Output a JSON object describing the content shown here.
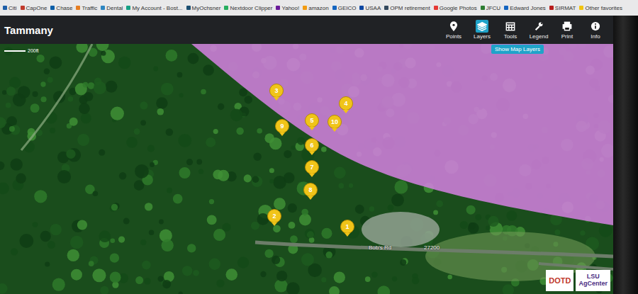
{
  "bookmarks": [
    {
      "label": "Citi"
    },
    {
      "label": "CapOne"
    },
    {
      "label": "Chase"
    },
    {
      "label": "Traffic"
    },
    {
      "label": "Dental"
    },
    {
      "label": "My Account - Bost..."
    },
    {
      "label": "MyOchsner"
    },
    {
      "label": "Nextdoor Clipper"
    },
    {
      "label": "Yahoo!"
    },
    {
      "label": "amazon"
    },
    {
      "label": "GEICO"
    },
    {
      "label": "USAA"
    },
    {
      "label": "OPM retirement"
    },
    {
      "label": "Google Photos"
    },
    {
      "label": "JFCU"
    },
    {
      "label": "Edward Jones"
    },
    {
      "label": "SIRMAT"
    },
    {
      "label": "Other favorites"
    }
  ],
  "app": {
    "title": "Tammany"
  },
  "toolbar": [
    {
      "label": "Points",
      "selected": false
    },
    {
      "label": "Layers",
      "selected": true
    },
    {
      "label": "Tools",
      "selected": false
    },
    {
      "label": "Legend",
      "selected": false
    },
    {
      "label": "Print",
      "selected": false
    },
    {
      "label": "Info",
      "selected": false
    }
  ],
  "tooltip": "Show Map Layers",
  "map": {
    "scale": "200ft",
    "roads": [
      {
        "label": "Bob's Rd"
      },
      {
        "label": "27200"
      }
    ],
    "pins": [
      {
        "label": "1"
      },
      {
        "label": "2"
      },
      {
        "label": "3"
      },
      {
        "label": "4"
      },
      {
        "label": "5"
      },
      {
        "label": "6"
      },
      {
        "label": "7"
      },
      {
        "label": "8"
      },
      {
        "label": "9"
      },
      {
        "label": "10"
      }
    ]
  },
  "logos": [
    {
      "lines": [
        "DOTD"
      ]
    },
    {
      "lines": [
        "LSU",
        "AgCenter"
      ]
    }
  ]
}
